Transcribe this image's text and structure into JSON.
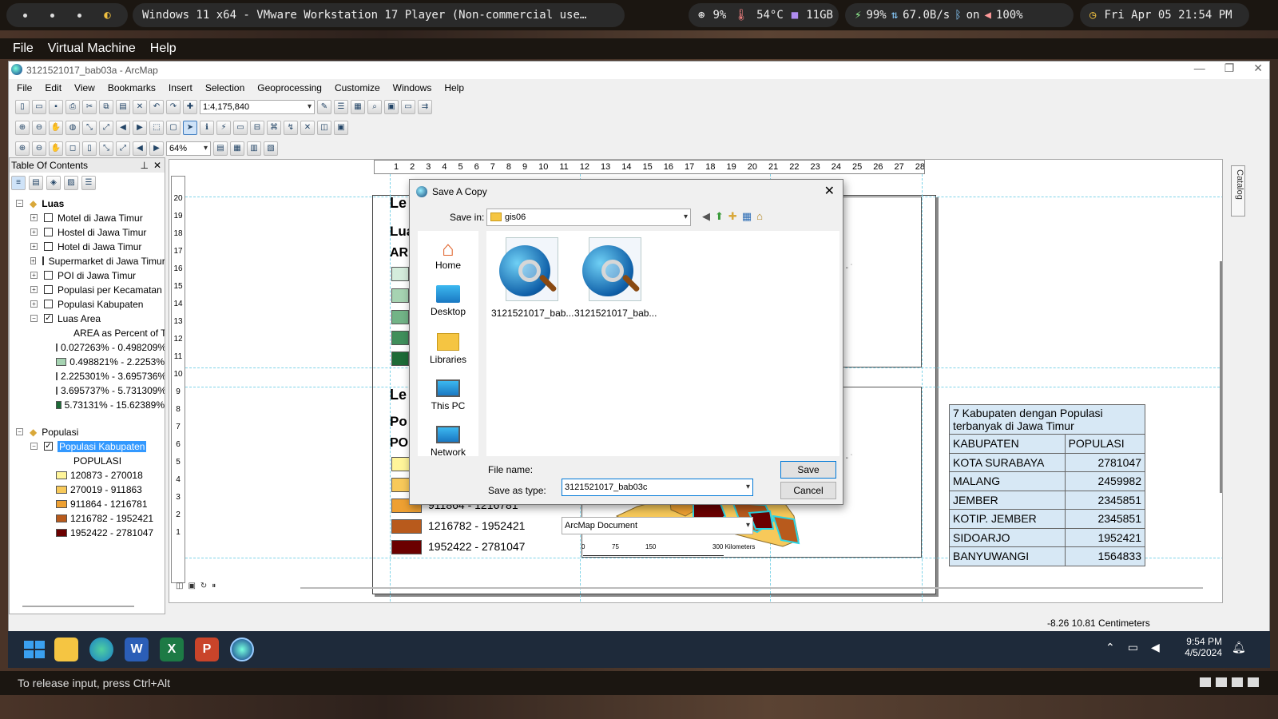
{
  "topbar": {
    "title": "Windows 11 x64 - VMware Workstation 17 Player (Non-commercial use…",
    "cpu": "9%",
    "temp": "54°C",
    "mem": "11GB",
    "battery": "99%",
    "net": "67.0B/s",
    "bluetooth": "on",
    "volume": "100%",
    "clock": "Fri Apr 05 21:54 PM"
  },
  "vm_menu": [
    "File",
    "Virtual Machine",
    "Help"
  ],
  "arcmap": {
    "title": "3121521017_bab03a - ArcMap",
    "menu": [
      "File",
      "Edit",
      "View",
      "Bookmarks",
      "Insert",
      "Selection",
      "Geoprocessing",
      "Customize",
      "Windows",
      "Help"
    ],
    "scale": "1:4,175,840",
    "zoom": "64%",
    "toc_title": "Table Of Contents",
    "status_coords": "-8.26  10.81 Centimeters"
  },
  "toc": {
    "group1": "Luas",
    "group1_layers": [
      "Motel di Jawa Timur",
      "Hostel di Jawa Timur",
      "Hotel di Jawa Timur",
      "Supermarket di Jawa Timur",
      "POI di Jawa Timur",
      "Populasi per Kecamatan",
      "Populasi Kabupaten",
      "Luas Area"
    ],
    "luas_field": "AREA as Percent of Total",
    "luas_classes": [
      {
        "label": "0.027263% - 0.498209%",
        "color": "#d4ecdc"
      },
      {
        "label": "0.498821% - 2.2253%",
        "color": "#a6d3b2"
      },
      {
        "label": "2.225301% - 3.695736%",
        "color": "#72b487"
      },
      {
        "label": "3.695737% - 5.731309%",
        "color": "#3f8f5b"
      },
      {
        "label": "5.73131% - 15.62389%",
        "color": "#1d6b37"
      }
    ],
    "group2": "Populasi",
    "group2_layer": "Populasi Kabupaten",
    "pop_field": "POPULASI",
    "pop_classes": [
      {
        "label": "120873 - 270018",
        "color": "#fff59a"
      },
      {
        "label": "270019 - 911863",
        "color": "#f7c95a"
      },
      {
        "label": "911864 - 1216781",
        "color": "#eea032"
      },
      {
        "label": "1216782 - 1952421",
        "color": "#b85a1c"
      },
      {
        "label": "1952422 - 2781047",
        "color": "#6b0000"
      }
    ]
  },
  "layout": {
    "legend1_title": "Le",
    "legend1_sub": "Lua",
    "legend1_field": "ARE",
    "legend2_title": "Le",
    "legend2_sub": "Po",
    "legend2_field": "POI",
    "legend2_items": [
      "911864 - 1216781",
      "1216782 - 1952421",
      "1952422 - 2781047"
    ],
    "scalebar": [
      "0",
      "75",
      "150",
      "300 Kilometers"
    ],
    "table_title": "7 Kabupaten dengan Populasi terbanyak di Jawa Timur",
    "table_headers": [
      "KABUPATEN",
      "POPULASI"
    ],
    "table_rows": [
      [
        "KOTA SURABAYA",
        "2781047"
      ],
      [
        "MALANG",
        "2459982"
      ],
      [
        "JEMBER",
        "2345851"
      ],
      [
        "KOTIP. JEMBER",
        "2345851"
      ],
      [
        "SIDOARJO",
        "1952421"
      ],
      [
        "BANYUWANGI",
        "1564833"
      ]
    ],
    "catalog_tab": "Catalog"
  },
  "dialog": {
    "title": "Save A Copy",
    "save_in_label": "Save in:",
    "save_in_value": "gis06",
    "places": [
      "Home",
      "Desktop",
      "Libraries",
      "This PC",
      "Network"
    ],
    "files": [
      "3121521017_bab...",
      "3121521017_bab..."
    ],
    "filename_label": "File name:",
    "filename_value": "3121521017_bab03c",
    "type_label": "Save as type:",
    "type_value": "ArcMap Document",
    "save_button": "Save",
    "cancel_button": "Cancel"
  },
  "taskbar": {
    "time": "9:54 PM",
    "date": "4/5/2024"
  },
  "vm_status": "To release input, press Ctrl+Alt",
  "colors": {
    "accent": "#0078d7",
    "toc_selected": "#3399ff",
    "table_bg": "#d7e8f5"
  }
}
